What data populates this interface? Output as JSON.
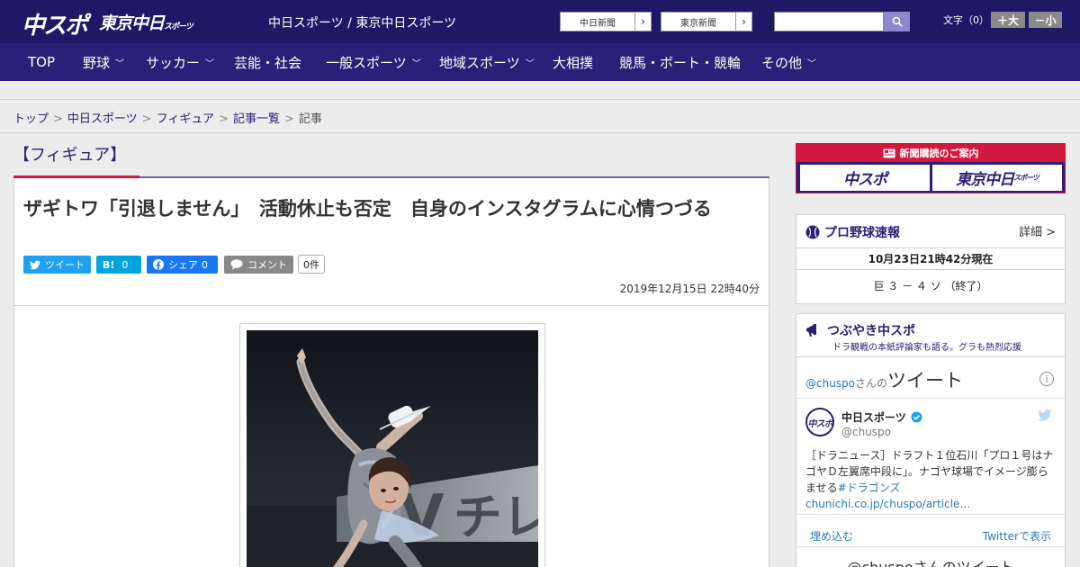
{
  "header": {
    "logo_chuspo": "中スポ",
    "logo_tokyo": "東京中日",
    "logo_tokyo_sub": "スポーツ",
    "site_title": "中日スポーツ / 東京中日スポーツ",
    "links": [
      "中日新聞",
      "東京新聞"
    ],
    "fontsize_label": "文字（0）",
    "font_bigger": "＋大",
    "font_smaller": "－小"
  },
  "nav": {
    "items": [
      {
        "label": "TOP"
      },
      {
        "label": "野球"
      },
      {
        "label": "サッカー"
      },
      {
        "label": "芸能・社会"
      },
      {
        "label": "一般スポーツ"
      },
      {
        "label": "地域スポーツ"
      },
      {
        "label": "大相撲"
      },
      {
        "label": "競馬・ボート・競輪"
      },
      {
        "label": "その他"
      }
    ]
  },
  "breadcrumb": {
    "items": [
      "トップ",
      "中日スポーツ",
      "フィギュア",
      "記事一覧"
    ],
    "current": "記事",
    "sep": ">"
  },
  "article": {
    "category": "【フィギュア】",
    "headline": "ザギトワ「引退しません」　活動休止も否定　自身のインスタグラムに心情つづる",
    "share": {
      "tweet": "ツイート",
      "hatena_label": "B!",
      "hatena_count": "0",
      "fb_label": "シェア",
      "fb_count": "0",
      "comment": "コメント",
      "comment_count": "0件"
    },
    "date": "2019年12月15日 22時40分"
  },
  "sidebar": {
    "subscribe_title": "新聞購読のご案内",
    "sub_logo1": "中スポ",
    "sub_logo2": "東京中日",
    "sub_logo2_sub": "スポーツ",
    "baseball": {
      "title": "プロ野球速報",
      "detail": "詳細 >",
      "time": "10月23日21時42分現在",
      "score": "巨 ３ － ４ ソ （終了）"
    },
    "tweets": {
      "title": "つぶやき中スポ",
      "subtitle": "ドラ観戦の本紙評論家も語る。グラも熱烈応援",
      "feed_handle": "@chuspo",
      "feed_handle_suffix": "さんの",
      "feed_title": "ツイート",
      "user_name": "中日スポーツ",
      "user_handle": "@chuspo",
      "avatar_text": "中スポ",
      "tweet_text": "［ドラニュース］ドラフト１位石川「プロ１号はナゴヤＤ左翼席中段に」。ナゴヤ球場でイメージ膨らませる",
      "tweet_link": "#ドラゴンズchunichi.co.jp/chuspo/article…",
      "embed": "埋め込む",
      "view_on": "Twitterで表示",
      "footer": "@chuspoさんのツイート"
    }
  },
  "colors": {
    "header_bg": "#1f1866",
    "nav_bg": "#2a2077",
    "accent_red": "#d4173c",
    "twitter": "#1da1f2",
    "hatena": "#00a4de",
    "facebook": "#1877f2"
  }
}
